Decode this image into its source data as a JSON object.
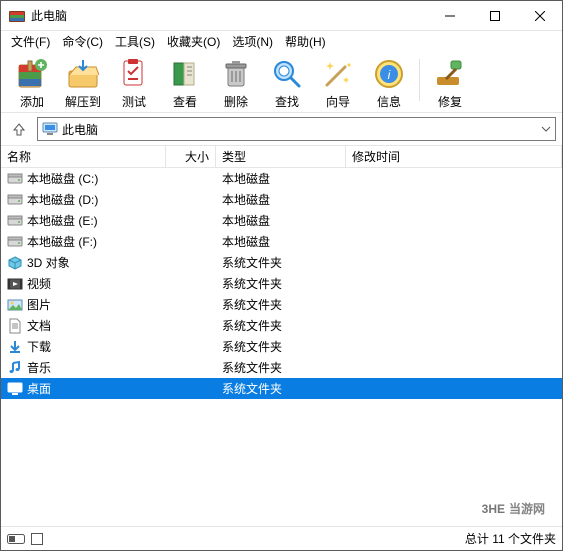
{
  "window": {
    "title": "此电脑",
    "addressText": "此电脑"
  },
  "menu": {
    "file": "文件(F)",
    "cmd": "命令(C)",
    "tools": "工具(S)",
    "fav": "收藏夹(O)",
    "options": "选项(N)",
    "help": "帮助(H)"
  },
  "toolbar": {
    "add": "添加",
    "extract": "解压到",
    "test": "测试",
    "view": "查看",
    "delete": "删除",
    "find": "查找",
    "wizard": "向导",
    "info": "信息",
    "repair": "修复"
  },
  "columns": {
    "name": "名称",
    "size": "大小",
    "type": "类型",
    "mtime": "修改时间"
  },
  "rows": [
    {
      "icon": "drive",
      "name": "本地磁盘 (C:)",
      "size": "",
      "type": "本地磁盘",
      "mtime": "",
      "selected": false
    },
    {
      "icon": "drive",
      "name": "本地磁盘 (D:)",
      "size": "",
      "type": "本地磁盘",
      "mtime": "",
      "selected": false
    },
    {
      "icon": "drive",
      "name": "本地磁盘 (E:)",
      "size": "",
      "type": "本地磁盘",
      "mtime": "",
      "selected": false
    },
    {
      "icon": "drive",
      "name": "本地磁盘 (F:)",
      "size": "",
      "type": "本地磁盘",
      "mtime": "",
      "selected": false
    },
    {
      "icon": "3d",
      "name": "3D 对象",
      "size": "",
      "type": "系统文件夹",
      "mtime": "",
      "selected": false
    },
    {
      "icon": "video",
      "name": "视频",
      "size": "",
      "type": "系统文件夹",
      "mtime": "",
      "selected": false
    },
    {
      "icon": "pic",
      "name": "图片",
      "size": "",
      "type": "系统文件夹",
      "mtime": "",
      "selected": false
    },
    {
      "icon": "doc",
      "name": "文档",
      "size": "",
      "type": "系统文件夹",
      "mtime": "",
      "selected": false
    },
    {
      "icon": "down",
      "name": "下载",
      "size": "",
      "type": "系统文件夹",
      "mtime": "",
      "selected": false
    },
    {
      "icon": "music",
      "name": "音乐",
      "size": "",
      "type": "系统文件夹",
      "mtime": "",
      "selected": false
    },
    {
      "icon": "desk",
      "name": "桌面",
      "size": "",
      "type": "系统文件夹",
      "mtime": "",
      "selected": true
    }
  ],
  "status": {
    "text": "总计 11 个文件夹"
  },
  "watermark": {
    "l1": "3HE",
    "l2": "当游网"
  }
}
